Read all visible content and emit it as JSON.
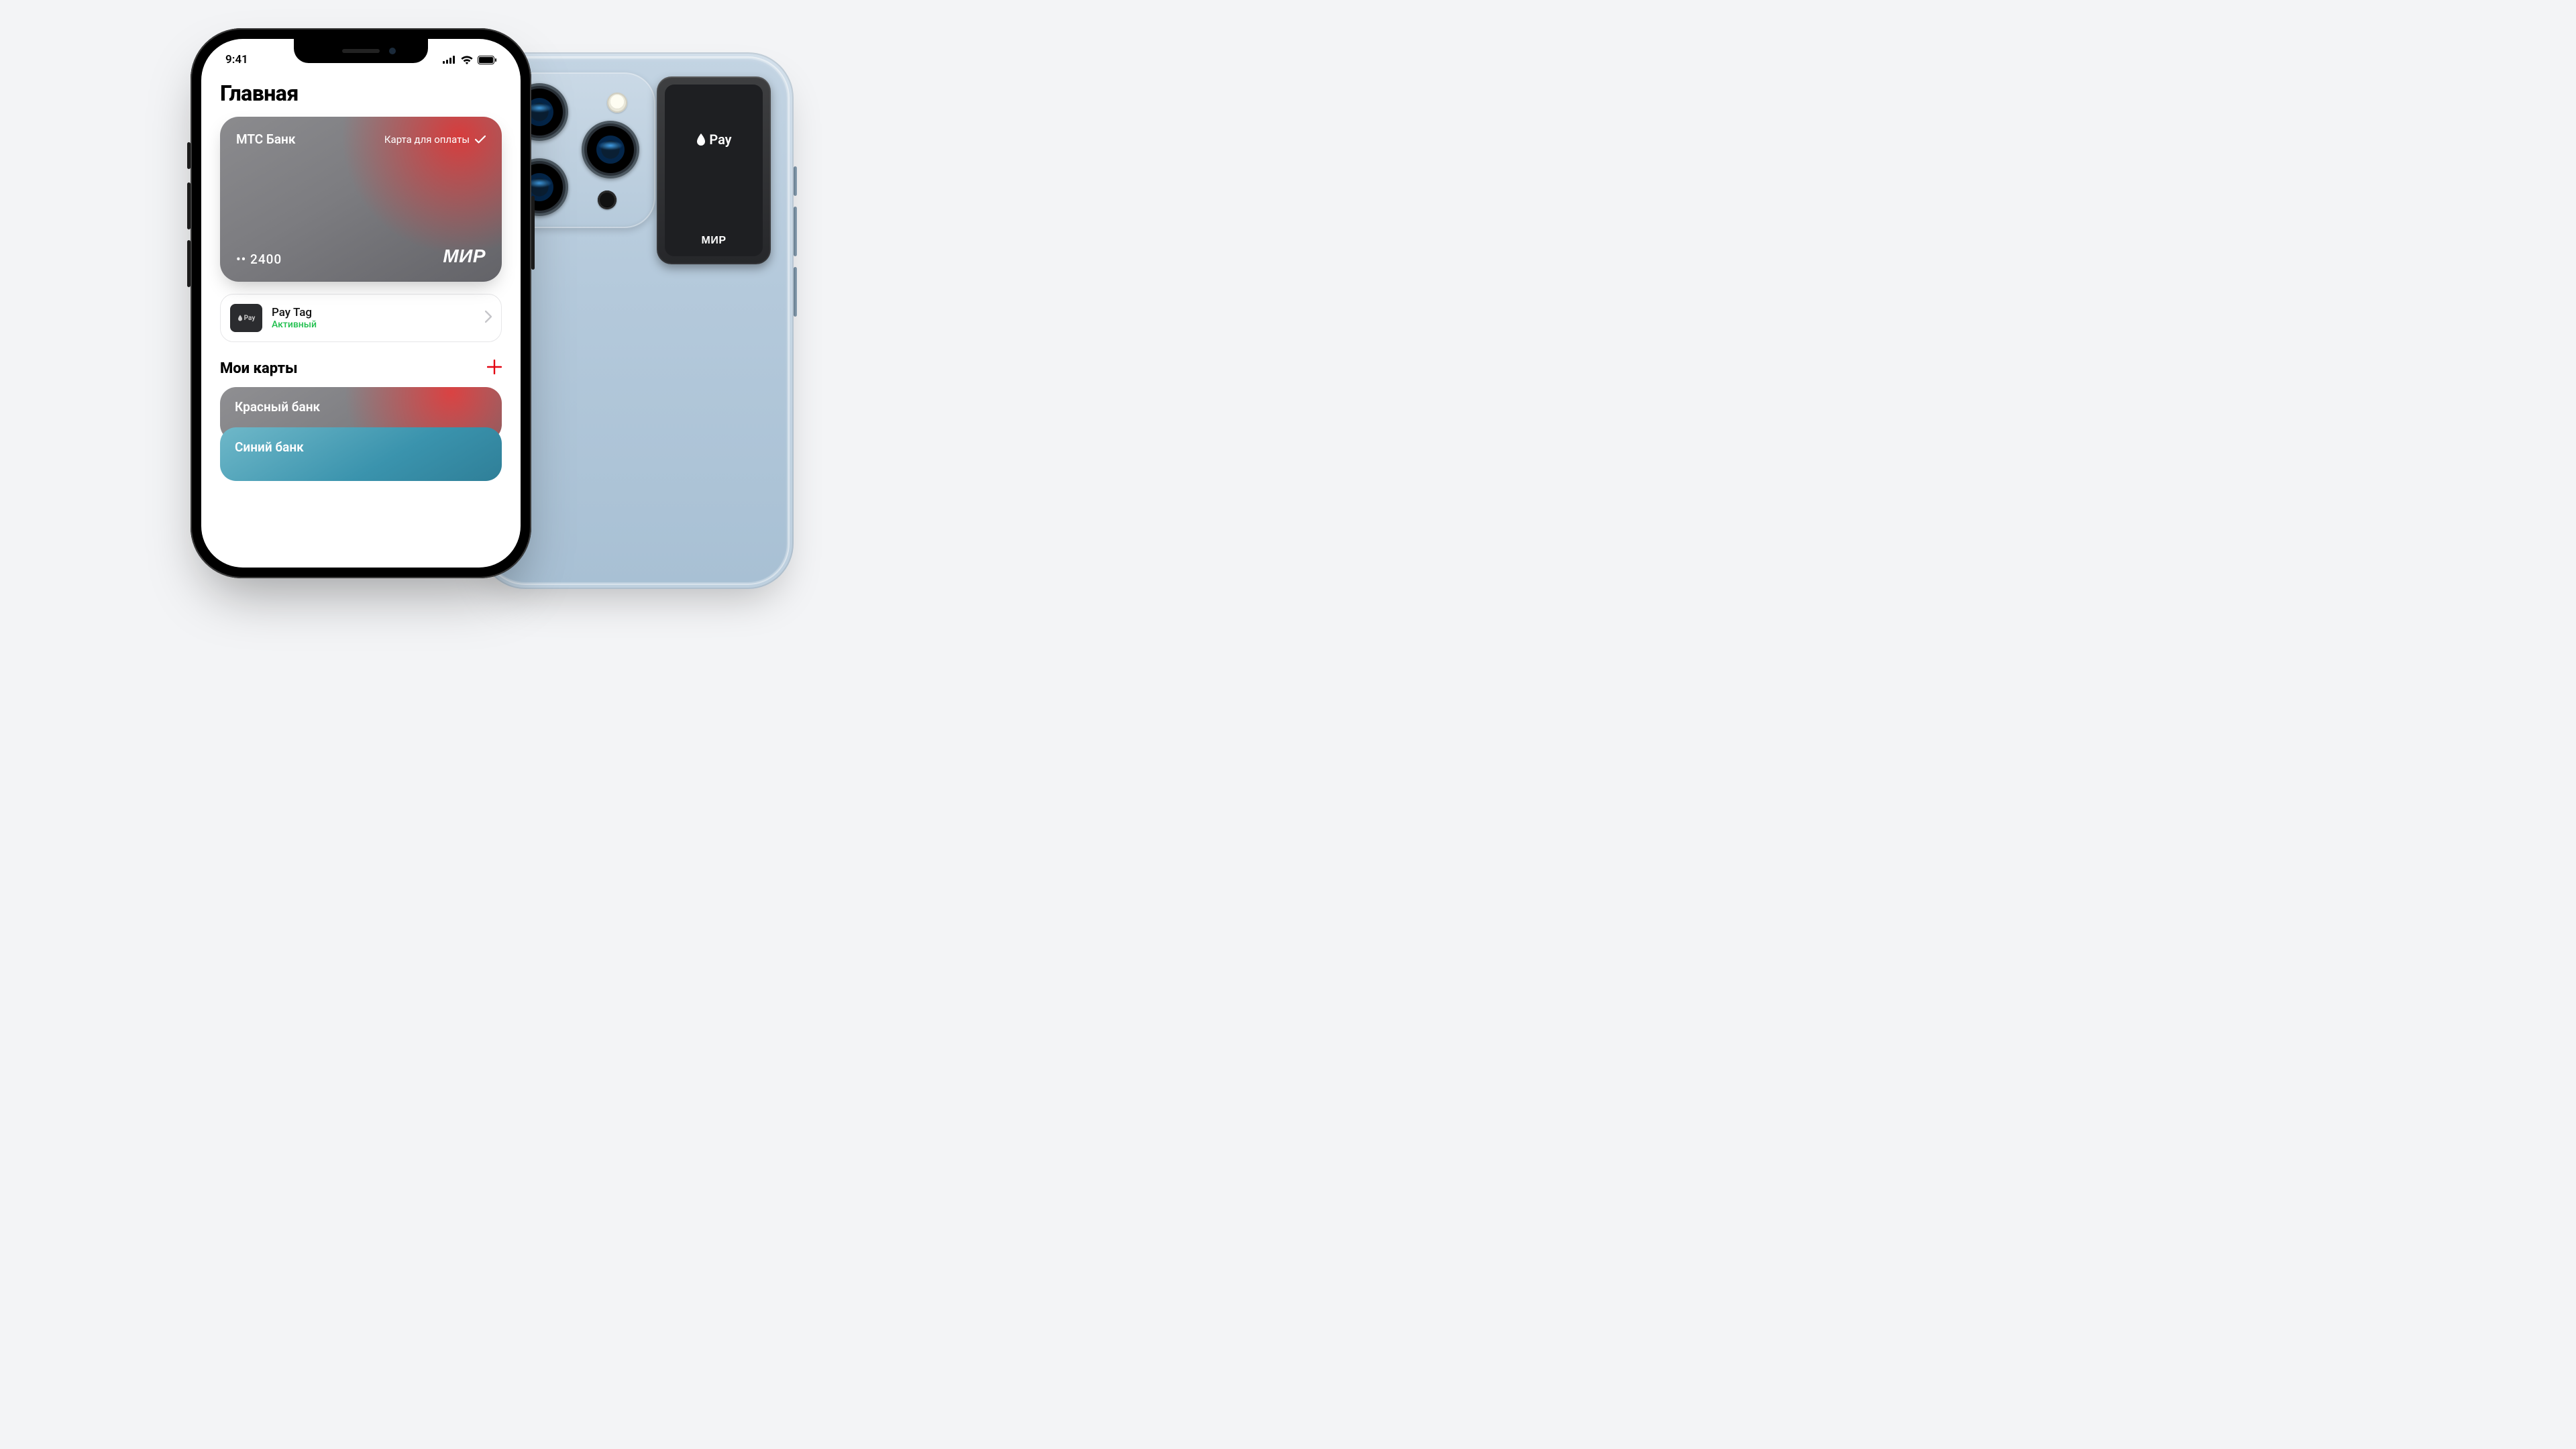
{
  "status": {
    "time": "9:41"
  },
  "page_title": "Главная",
  "main_card": {
    "bank": "МТС Банк",
    "label": "Карта для оплаты",
    "last4_prefix": "••",
    "last4": "2400",
    "network": "МИР"
  },
  "paytag_row": {
    "thumb_label": "Pay",
    "title": "Pay Tag",
    "status": "Активный"
  },
  "my_cards": {
    "title": "Мои карты",
    "items": [
      {
        "name": "Красный банк"
      },
      {
        "name": "Синий банк"
      }
    ]
  },
  "tag_device": {
    "label": "Pay",
    "network": "МИР"
  }
}
